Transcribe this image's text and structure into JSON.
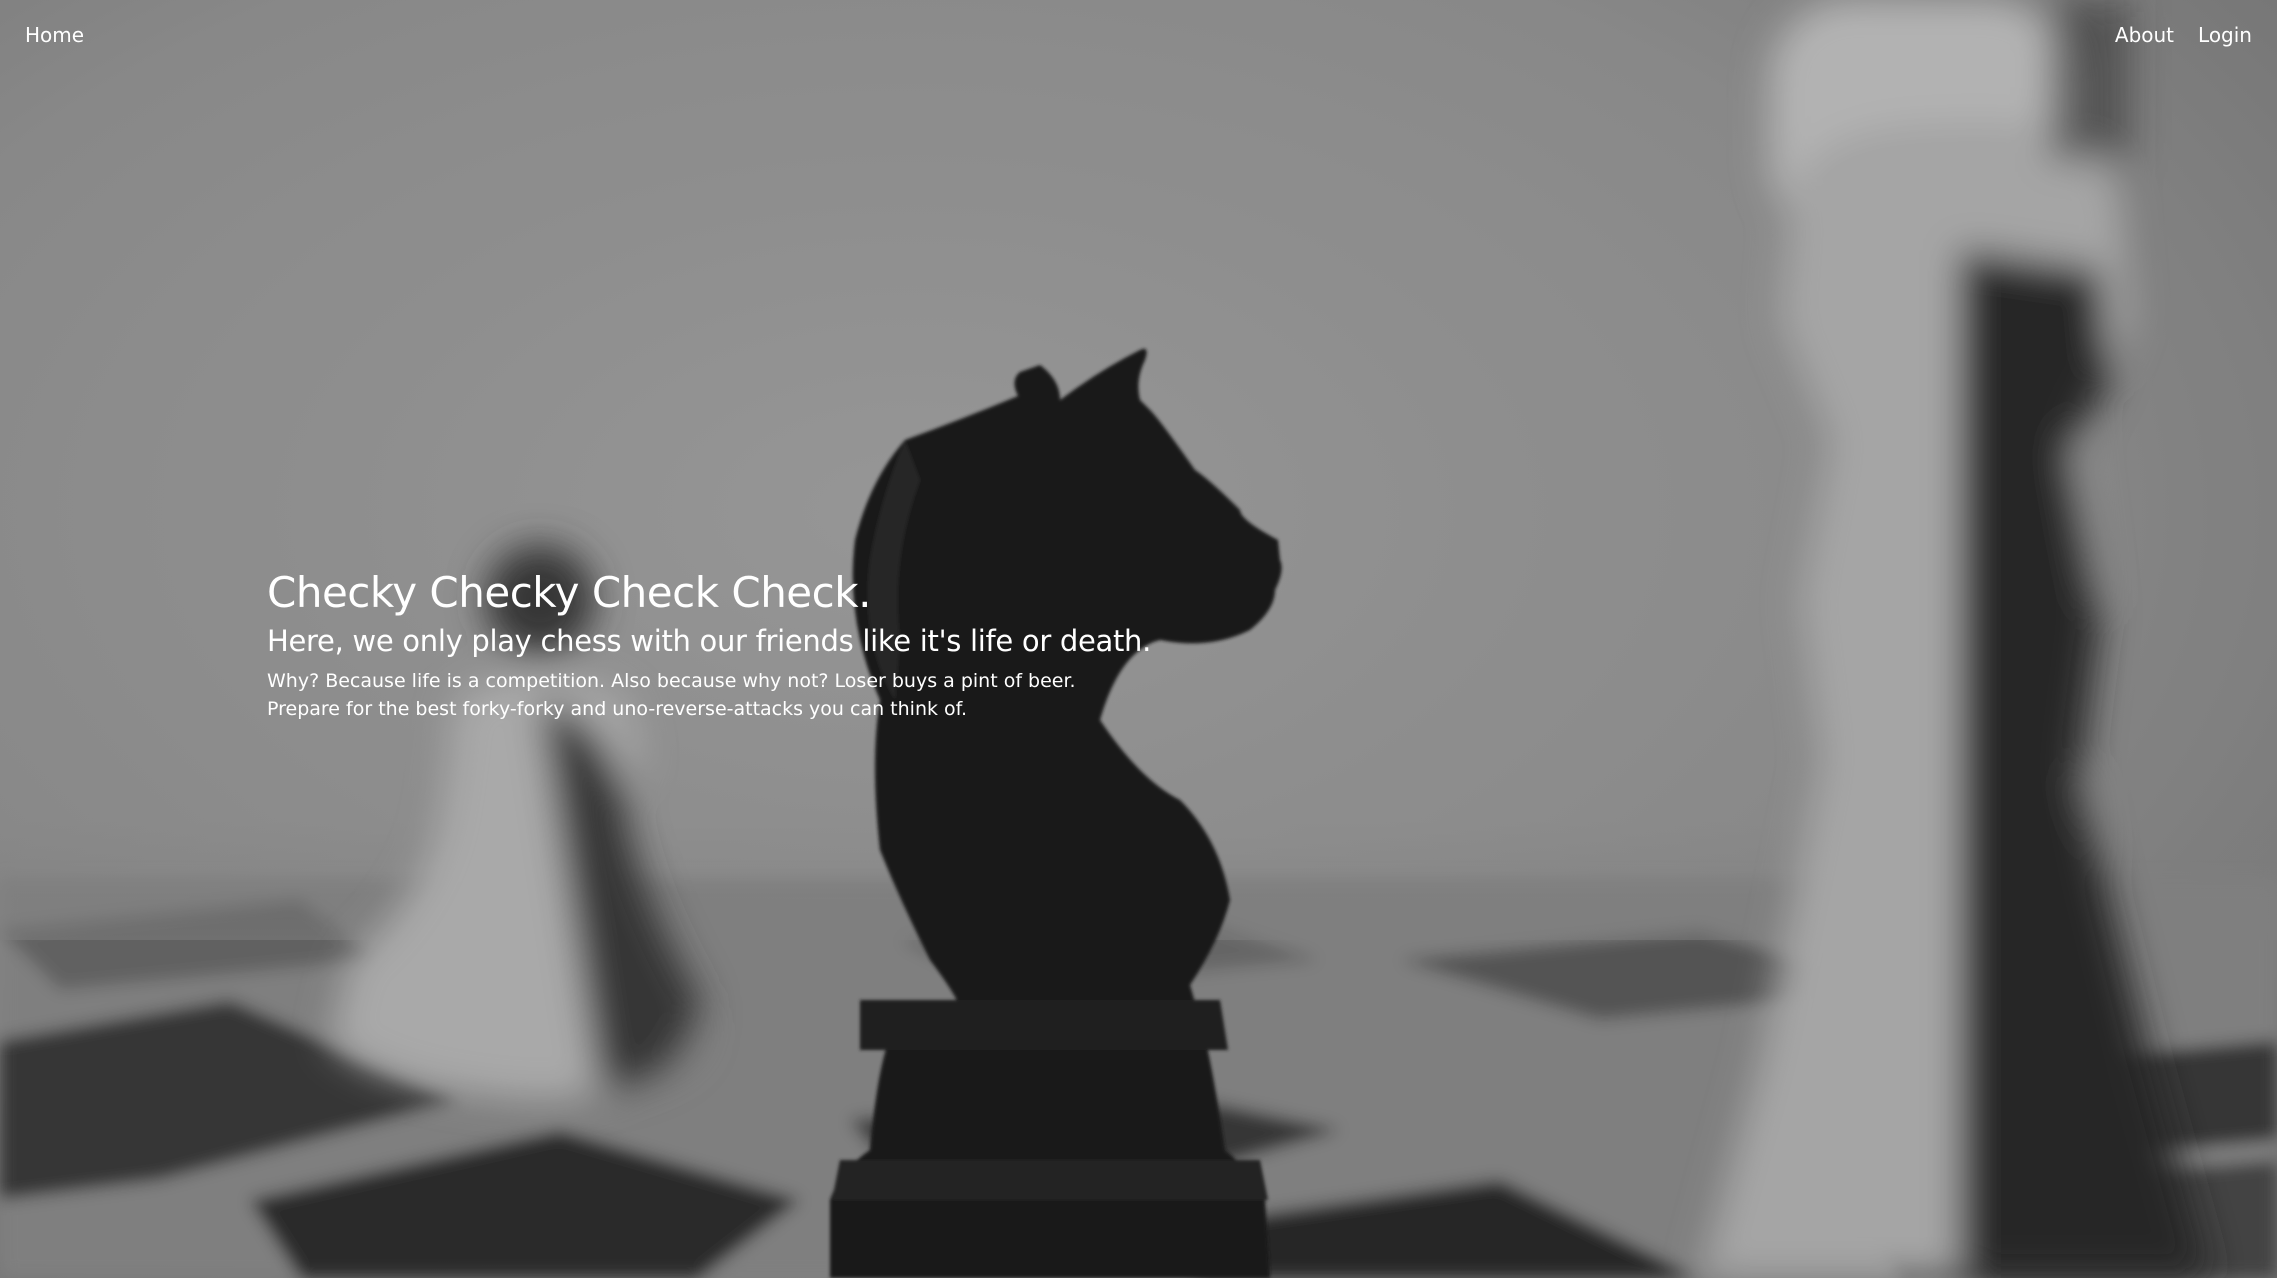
{
  "nav": {
    "home_label": "Home",
    "about_label": "About",
    "login_label": "Login"
  },
  "hero": {
    "title": "Checky Checky Check Check.",
    "subtitle": "Here, we only play chess with our friends like it's life or death.",
    "line1": "Why? Because life is a competition. Also because why not? Loser buys a pint of beer.",
    "line2": "Prepare for the best forky-forky and uno-reverse-attacks you can think of."
  },
  "colors": {
    "text": "#ffffff",
    "background": "#8f8f8f",
    "piece_dark": "#1c1c1c"
  },
  "background_image": {
    "subject": "black-and-white-chess-photo",
    "icons": [
      "knight-piece",
      "pawn-piece",
      "king-piece"
    ]
  }
}
